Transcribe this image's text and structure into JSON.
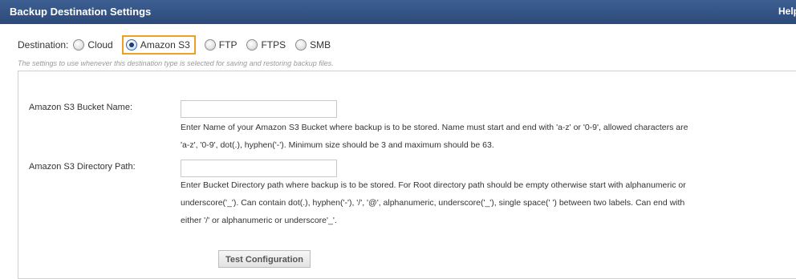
{
  "header": {
    "title": "Backup Destination Settings",
    "help_label": "Help"
  },
  "destination": {
    "label": "Destination:",
    "options": [
      {
        "label": "Cloud",
        "selected": false
      },
      {
        "label": "Amazon S3",
        "selected": true
      },
      {
        "label": "FTP",
        "selected": false
      },
      {
        "label": "FTPS",
        "selected": false
      },
      {
        "label": "SMB",
        "selected": false
      }
    ],
    "hint": "The settings to use whenever this destination type is selected for saving and restoring backup files."
  },
  "form": {
    "bucket": {
      "label": "Amazon S3 Bucket Name:",
      "value": "",
      "desc_lines": [
        "Enter Name of your Amazon S3 Bucket where backup is to be stored. Name must start and end with 'a-z' or '0-9', allowed characters are",
        "'a-z', '0-9', dot(.), hyphen('-'). Minimum size should be 3 and maximum should be 63."
      ]
    },
    "directory": {
      "label": "Amazon S3 Directory Path:",
      "value": "",
      "desc_lines": [
        "Enter Bucket Directory path where backup is to be stored. For Root directory path should be empty otherwise start with alphanumeric or",
        "underscore('_'). Can contain dot(.), hyphen('-'), '/', '@', alphanumeric, underscore('_'), single space(' ') between two labels. Can end with",
        "either '/' or alphanumeric or underscore'_'."
      ]
    }
  },
  "buttons": {
    "test_config": "Test Configuration"
  },
  "colors": {
    "header_bg": "#2f4f80",
    "selected_highlight": "#f0a020"
  }
}
